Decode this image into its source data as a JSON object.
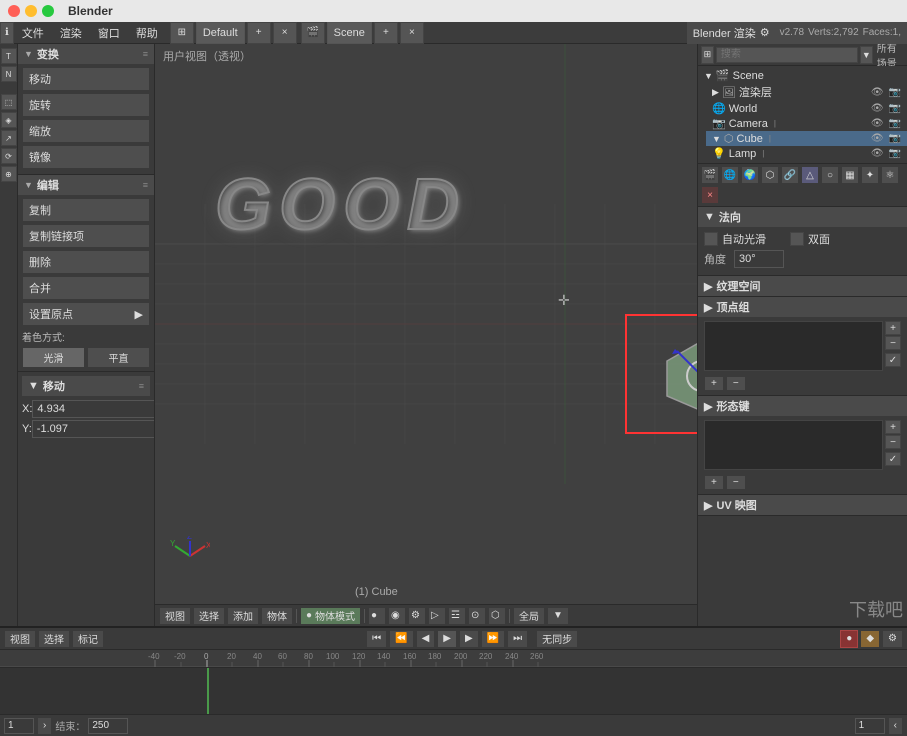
{
  "titlebar": {
    "app_name": "Blender"
  },
  "menubar": {
    "info_icon": "ℹ",
    "file": "文件",
    "render": "渲染",
    "window": "窗口",
    "help": "帮助",
    "layout_icon": "⊞",
    "layout_label": "Default",
    "scene_icon": "🎬",
    "scene_label": "Scene",
    "engine_label": "Blender 渲染",
    "version": "v2.78",
    "verts": "Verts:2,792",
    "faces": "Faces:1,"
  },
  "left_panel": {
    "transform_header": "变换",
    "move_btn": "移动",
    "rotate_btn": "旋转",
    "scale_btn": "缩放",
    "mirror_btn": "镜像",
    "edit_header": "编辑",
    "copy_btn": "复制",
    "copy_link_btn": "复制链接项",
    "delete_btn": "删除",
    "merge_btn": "合并",
    "set_origin_btn": "设置原点",
    "color_label": "着色方式:",
    "smooth_btn": "光滑",
    "flat_btn": "平直",
    "move_header": "移动",
    "x_label": "X:",
    "x_value": "4.934",
    "y_label": "Y:",
    "y_value": "-1.097"
  },
  "viewport": {
    "header": "用户视图（透视）",
    "cube_label": "(1) Cube",
    "bottom_btns": {
      "view": "视图",
      "select": "选择",
      "add": "添加",
      "object": "物体",
      "mode": "物体模式",
      "global": "全局"
    }
  },
  "right_panel": {
    "scene_label": "Scene",
    "search_placeholder": "搜索",
    "all_scenes": "所有场景",
    "render_layer": "渲染层",
    "world": "World",
    "camera": "Camera",
    "cube": "Cube",
    "lamp": "Lamp",
    "normals_header": "法向",
    "auto_smooth": "自动光滑",
    "double_side": "双面",
    "angle": "角度",
    "angle_value": "30°",
    "texture_space_header": "纹理空间",
    "vertex_groups_header": "顶点组",
    "shape_keys_header": "形态键",
    "uv_maps_header": "UV 映图"
  },
  "timeline": {
    "view": "视图",
    "select": "选择",
    "frame_start": "1",
    "frame_end": "250",
    "end_label": "结束：",
    "end_value": "250",
    "frame_current": "1",
    "no_step": "无同步",
    "play_btns": [
      "⏮",
      "⏪",
      "◀",
      "▶",
      "⏩",
      "⏭"
    ],
    "ruler_marks": [
      "-40",
      "-20",
      "0",
      "20",
      "40",
      "60",
      "80",
      "100",
      "120",
      "140",
      "160",
      "180",
      "200",
      "220",
      "240",
      "260"
    ]
  },
  "icons": {
    "triangle_down": "▼",
    "triangle_right": "▶",
    "eye": "👁",
    "camera_small": "📷",
    "lamp_small": "💡",
    "world_small": "🌐",
    "cube_small": "⬡",
    "render_layer": "🖼",
    "plus": "+",
    "minus": "−",
    "check": "✓"
  }
}
